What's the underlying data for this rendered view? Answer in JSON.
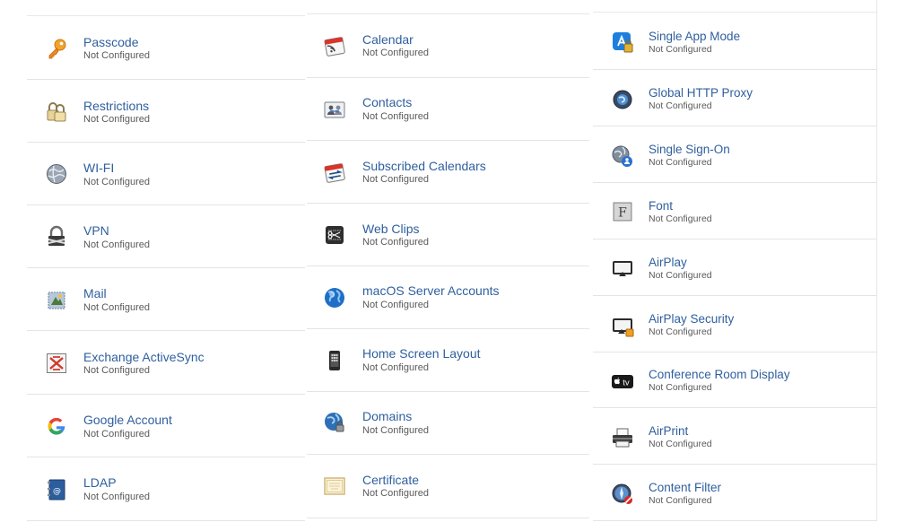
{
  "status_text": "Not Configured",
  "columns": [
    {
      "items": [
        {
          "label": "Passcode",
          "icon": "key-icon"
        },
        {
          "label": "Restrictions",
          "icon": "padlocks-icon"
        },
        {
          "label": "WI-FI",
          "icon": "globe-icon"
        },
        {
          "label": "VPN",
          "icon": "vpn-lock-icon"
        },
        {
          "label": "Mail",
          "icon": "mail-stamp-icon"
        },
        {
          "label": "Exchange ActiveSync",
          "icon": "exchange-icon"
        },
        {
          "label": "Google Account",
          "icon": "google-g-icon"
        },
        {
          "label": "LDAP",
          "icon": "address-book-icon"
        }
      ]
    },
    {
      "items": [
        {
          "label": "Calendar",
          "icon": "calendar-rss-icon"
        },
        {
          "label": "Contacts",
          "icon": "contacts-cards-icon"
        },
        {
          "label": "Subscribed Calendars",
          "icon": "calendar-sync-icon"
        },
        {
          "label": "Web Clips",
          "icon": "scissors-icon"
        },
        {
          "label": "macOS Server Accounts",
          "icon": "globe-blue-icon"
        },
        {
          "label": "Home Screen Layout",
          "icon": "phone-grid-icon"
        },
        {
          "label": "Domains",
          "icon": "globe-lock-icon"
        },
        {
          "label": "Certificate",
          "icon": "certificate-icon"
        }
      ]
    },
    {
      "items": [
        {
          "label": "Single App Mode",
          "icon": "app-store-lock-icon"
        },
        {
          "label": "Global HTTP Proxy",
          "icon": "proxy-globe-icon"
        },
        {
          "label": "Single Sign-On",
          "icon": "globe-person-icon"
        },
        {
          "label": "Font",
          "icon": "font-f-icon"
        },
        {
          "label": "AirPlay",
          "icon": "airplay-icon"
        },
        {
          "label": "AirPlay Security",
          "icon": "airplay-lock-icon"
        },
        {
          "label": "Conference Room Display",
          "icon": "apple-tv-icon"
        },
        {
          "label": "AirPrint",
          "icon": "printer-icon"
        },
        {
          "label": "Content Filter",
          "icon": "compass-filter-icon"
        }
      ]
    }
  ]
}
